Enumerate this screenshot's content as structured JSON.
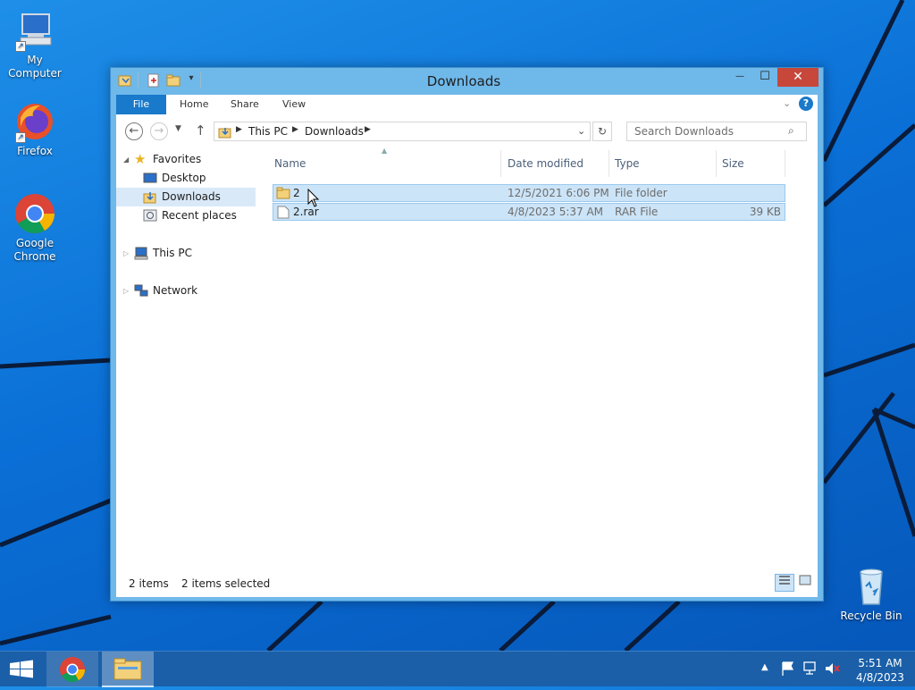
{
  "desktop": {
    "icons": [
      {
        "label": "My Computer"
      },
      {
        "label": "Firefox"
      },
      {
        "label": "Google Chrome"
      },
      {
        "label": "Recycle Bin"
      }
    ]
  },
  "window": {
    "title": "Downloads",
    "controls": {
      "minimize": "—",
      "maximize": "☐",
      "close": "✕"
    }
  },
  "ribbon": {
    "tabs": [
      {
        "label": "File"
      },
      {
        "label": "Home"
      },
      {
        "label": "Share"
      },
      {
        "label": "View"
      }
    ]
  },
  "address": {
    "crumbs": [
      "This PC",
      "Downloads"
    ],
    "search_placeholder": "Search Downloads"
  },
  "navpane": {
    "items": [
      {
        "label": "Favorites"
      },
      {
        "label": "Desktop"
      },
      {
        "label": "Downloads"
      },
      {
        "label": "Recent places"
      },
      {
        "label": "This PC"
      },
      {
        "label": "Network"
      }
    ]
  },
  "filelist": {
    "columns": [
      "Name",
      "Date modified",
      "Type",
      "Size"
    ],
    "rows": [
      {
        "name": "2",
        "date": "12/5/2021 6:06 PM",
        "type": "File folder",
        "size": ""
      },
      {
        "name": "2.rar",
        "date": "4/8/2023 5:37 AM",
        "type": "RAR File",
        "size": "39 KB"
      }
    ]
  },
  "status": {
    "items_count": "2 items",
    "selected_count": "2 items selected"
  },
  "taskbar": {
    "time": "5:51 AM",
    "date": "4/8/2023"
  },
  "colors": {
    "accent": "#1979ca",
    "selection": "#cce4f7",
    "close": "#c7473b"
  }
}
